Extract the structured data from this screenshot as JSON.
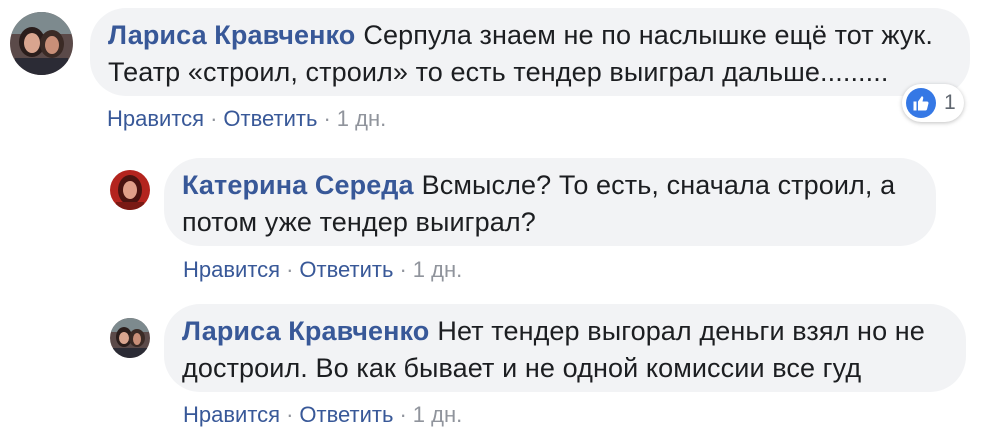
{
  "comments": [
    {
      "author": "Лариса Кравченко",
      "lines": [
        "Серпула знаем не по наслышке ещё тот жук.",
        "Театр «строил, строил» то есть тендер выиграл дальше........."
      ],
      "actions": {
        "like": "Нравится",
        "reply": "Ответить",
        "sep": "·",
        "time": "1 дн."
      },
      "reaction": {
        "icon": "thumbs-up-icon",
        "count": "1"
      }
    },
    {
      "author": "Катерина Середа",
      "lines": [
        "Всмысле? То есть, сначала строил, а",
        "потом уже тендер выиграл?"
      ],
      "actions": {
        "like": "Нравится",
        "reply": "Ответить",
        "sep": "·",
        "time": "1 дн."
      }
    },
    {
      "author": "Лариса Кравченко",
      "lines": [
        "Нет тендер выгорал деньги взял но не",
        "достроил. Во как бывает и не одной комиссии все гуд"
      ],
      "actions": {
        "like": "Нравится",
        "reply": "Ответить",
        "sep": "·",
        "time": "1 дн."
      }
    }
  ],
  "colors": {
    "link": "#385898",
    "meta": "#90949c",
    "bubble": "#f2f3f5",
    "like": "#3578e5"
  }
}
